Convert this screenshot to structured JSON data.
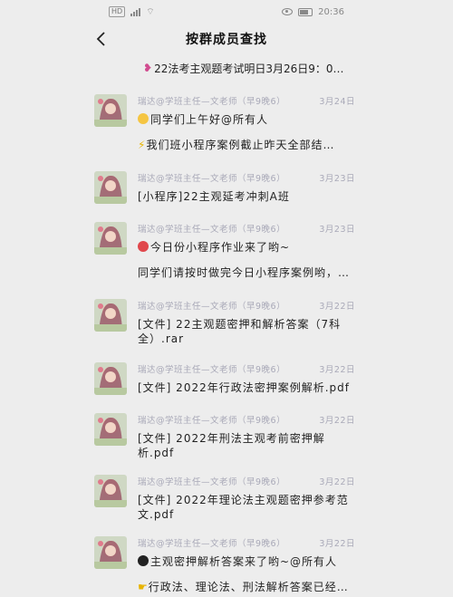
{
  "status_bar": {
    "hd_badge": "HD",
    "signal_label": "4G",
    "battery_badge": "▭",
    "time": "20:36"
  },
  "header": {
    "title": "按群成员查找"
  },
  "pinned_message": {
    "text": "22法考主观题考试明日3月26日9：0…"
  },
  "sender_label": "瑞达@学班主任—文老师（早9晚6）",
  "messages": [
    {
      "date": "3月24日",
      "line1": "同学们上午好@所有人",
      "line2": "我们班小程序案例截止昨天全部结…",
      "emoji1": "sun",
      "emoji2": "lightning"
    },
    {
      "date": "3月23日",
      "line1": "[小程序]22主观延考冲刺A班"
    },
    {
      "date": "3月23日",
      "line1": "今日份小程序作业来了哟~",
      "line2": "同学们请按时做完今日小程序案例哟，…",
      "emoji1": "balloon"
    },
    {
      "date": "3月22日",
      "line1": "[文件] 22主观题密押和解析答案（7科全）.rar"
    },
    {
      "date": "3月22日",
      "line1": "[文件] 2022年行政法密押案例解析.pdf"
    },
    {
      "date": "3月22日",
      "line1": "[文件] 2022年刑法主观考前密押解析.pdf"
    },
    {
      "date": "3月22日",
      "line1": "[文件] 2022年理论法主观题密押参考范文.pdf"
    },
    {
      "date": "3月22日",
      "line1": "主观密押解析答案来了哟~@所有人",
      "line2": "行政法、理论法、刑法解析答案已经…",
      "emoji1": "penguin",
      "emoji2": "hand"
    }
  ]
}
